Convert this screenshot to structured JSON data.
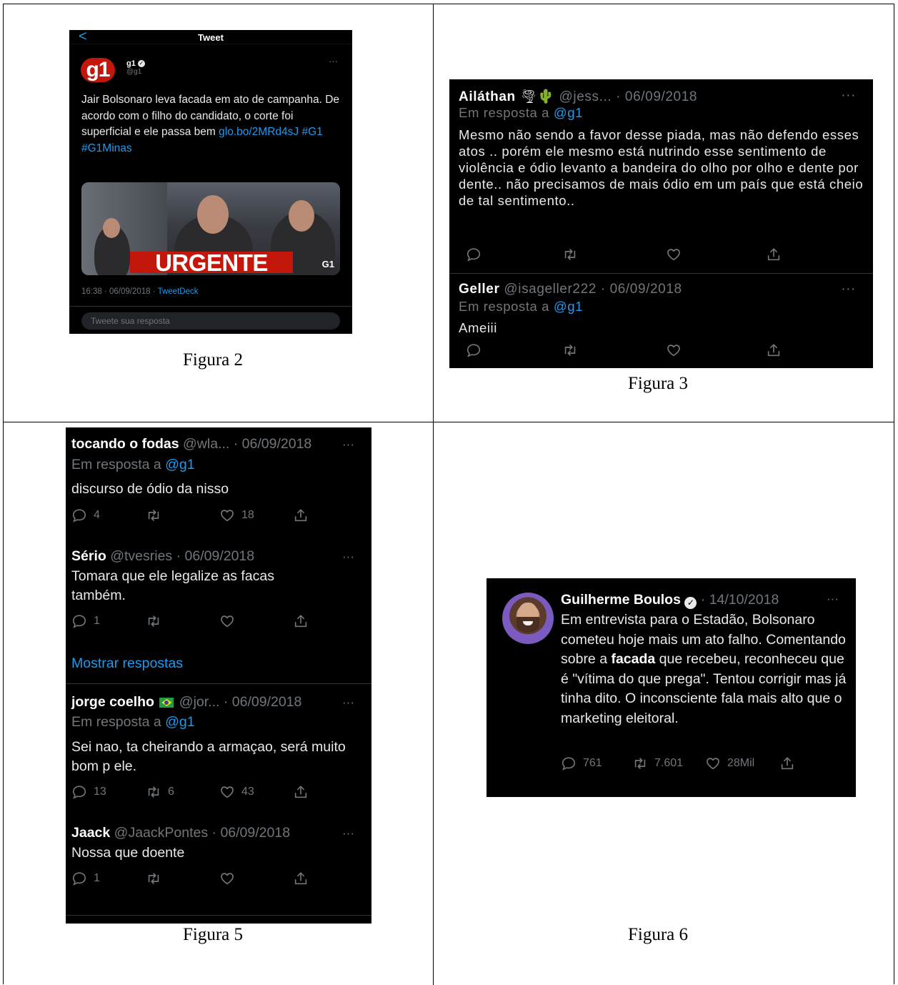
{
  "captions": {
    "fig2": "Figura 2",
    "fig3": "Figura 3",
    "fig5": "Figura 5",
    "fig6": "Figura 6"
  },
  "icons": {
    "back": "chevron-left-icon",
    "reply": "speech-bubble-icon",
    "retweet": "retweet-icon",
    "like": "heart-icon",
    "share": "share-icon",
    "more": "more-icon",
    "verified": "verified-badge-icon"
  },
  "colors": {
    "background": "#000000",
    "text": "#e7e9ea",
    "muted": "#71767b",
    "link": "#1d9bf0",
    "g1_red": "#c4170c"
  },
  "fig2": {
    "back_glyph": "<",
    "title": "Tweet",
    "logo_text": "g1",
    "name": "g1",
    "handle": "@g1",
    "more": "···",
    "text_plain": "Jair Bolsonaro leva facada em ato de campanha. De acordo com o filho do candidato, o corte foi superficial e ele passa bem ",
    "text_link": "glo.bo/2MRd4sJ #G1 #G1Minas",
    "image_banner": "URGENTE",
    "image_mark": "G1",
    "timestamp": "16:38 · 06/09/2018 · ",
    "source": "TweetDeck",
    "reply_placeholder": "Tweete sua resposta"
  },
  "fig3": {
    "tweets": [
      {
        "name": "Ailáthan",
        "emoji": "🌪🌵",
        "handle": "@jess...",
        "date": " · 06/09/2018",
        "more": "···",
        "reply_prefix": "Em resposta a ",
        "reply_to": "@g1",
        "text": "Mesmo não sendo a favor desse piada, mas não defendo esses atos .. porém ele mesmo está nutrindo esse sentimento de violência e ódio levanto a bandeira do olho por olho e dente por dente.. não precisamos de mais ódio em um país que está cheio de tal sentimento.."
      },
      {
        "name": "Geller",
        "handle": "@isageller222",
        "date": " · 06/09/2018",
        "more": "···",
        "reply_prefix": "Em resposta a ",
        "reply_to": "@g1",
        "text": "Ameiii"
      }
    ]
  },
  "fig5": {
    "tweets": [
      {
        "name": "tocando o fodas",
        "handle": "@wla...",
        "date": " · 06/09/2018",
        "more": "···",
        "reply_prefix": "Em resposta a ",
        "reply_to": "@g1",
        "text": "discurso de ódio da nisso",
        "replies": "4",
        "likes": "18"
      },
      {
        "name": "Sério",
        "handle": "@tvesries",
        "date": " · 06/09/2018",
        "more": "···",
        "text": "Tomara que ele legalize as facas também.",
        "replies": "1"
      },
      {
        "name": "jorge coelho",
        "handle": "@jor...",
        "date": " · 06/09/2018",
        "more": "···",
        "reply_prefix": "Em resposta a ",
        "reply_to": "@g1",
        "text": "Sei nao, ta cheirando a armaçao, será muito bom p ele.",
        "replies": "13",
        "retweets": "6",
        "likes": "43"
      },
      {
        "name": "Jaack",
        "handle": "@JaackPontes",
        "date": " · 06/09/2018",
        "more": "···",
        "text": "Nossa que doente",
        "replies": "1"
      }
    ],
    "show_replies": "Mostrar respostas"
  },
  "fig6": {
    "name": "Guilherme Boulos",
    "date": " · 14/10/2018",
    "more": "···",
    "text_before": "Em entrevista para o Estadão, Bolsonaro cometeu hoje mais um ato falho. Comentando sobre a ",
    "text_bold": "facada",
    "text_after": " que recebeu, reconheceu que é \"vítima do que prega\". Tentou corrigir mas já tinha dito. O inconsciente fala mais alto que o marketing eleitoral.",
    "replies": "761",
    "retweets": "7.601",
    "likes": "28Mil"
  }
}
